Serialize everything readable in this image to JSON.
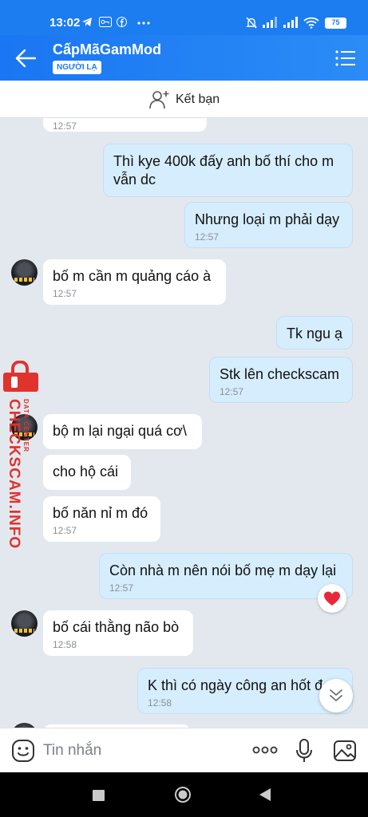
{
  "status_bar": {
    "time": "13:02",
    "battery": "75"
  },
  "header": {
    "title": "CấpMãGamMod",
    "badge": "NGƯỜI LẠ"
  },
  "add_friend": {
    "label": "Kết bạn"
  },
  "watermark": {
    "main": "CHECKSCAM.INFO",
    "sub": "DATA CENTER"
  },
  "messages": [
    {
      "dir": "in",
      "text": "",
      "time": "12:57"
    },
    {
      "dir": "out",
      "text": "Thì kye 400k đấy anh bố thí cho m",
      "text2": "vẫn dc",
      "time": ""
    },
    {
      "dir": "out",
      "text": "Nhưng loại m phải dạy",
      "time": "12:57"
    },
    {
      "dir": "in",
      "text": "bố m cần m quảng cáo à",
      "time": "12:57"
    },
    {
      "dir": "out",
      "text": "Tk ngu ạ",
      "time": ""
    },
    {
      "dir": "out",
      "text": "Stk lên checkscam",
      "time": "12:57"
    },
    {
      "dir": "in",
      "text": "bộ m lại ngại quá cơ\\",
      "time": ""
    },
    {
      "dir": "in",
      "text": "cho hộ cái",
      "time": ""
    },
    {
      "dir": "in",
      "text": "bố năn nỉ m đó",
      "time": "12:57"
    },
    {
      "dir": "out",
      "text": "Còn nhà m nên nói bố mẹ m dạy lại",
      "time": "12:57"
    },
    {
      "dir": "in",
      "text": "bố cái thằng não bò",
      "time": "12:58"
    },
    {
      "dir": "out",
      "text": "K thì có ngày công an hốt đ",
      "time": "12:58"
    }
  ],
  "input": {
    "placeholder": "Tin nhắn"
  },
  "icons": {
    "back": "arrow-left-icon",
    "menu": "list-menu-icon",
    "add_friend": "person-add-icon",
    "emoji": "emoji-icon",
    "more": "more-dots-icon",
    "mic": "microphone-icon",
    "image": "image-icon",
    "heart": "heart-icon",
    "chevron": "chevron-double-down-icon"
  },
  "colors": {
    "header": "#1b7df0",
    "out_bubble": "#d6edfd",
    "in_bubble": "#ffffff",
    "chat_bg": "#e3e8ef",
    "watermark": "#e0332d"
  }
}
